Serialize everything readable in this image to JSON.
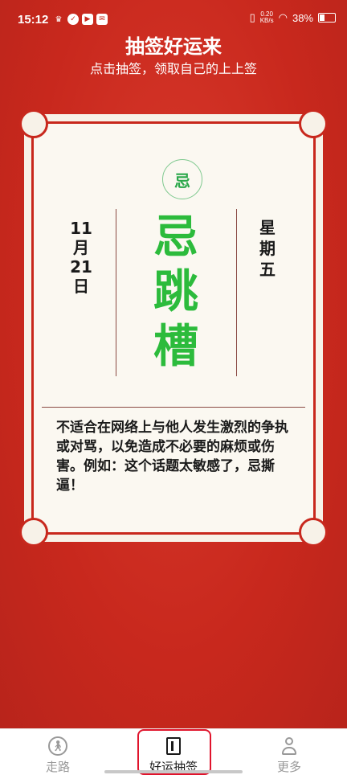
{
  "status_bar": {
    "time": "15:12",
    "net_speed": "0.20",
    "net_unit": "KB/s",
    "battery": "38%",
    "battery_level": 0.38
  },
  "header": {
    "title": "抽签好运来",
    "subtitle": "点击抽签，领取自己的上上签"
  },
  "card": {
    "badge": "忌",
    "date_chars": [
      "11",
      "月",
      "21",
      "日"
    ],
    "weekday_chars": [
      "星",
      "期",
      "五"
    ],
    "main_chars": [
      "忌",
      "跳",
      "槽"
    ],
    "description": "不适合在网络上与他人发生激烈的争执或对骂，以免造成不必要的麻烦或伤害。例如：这个话题太敏感了，忌撕逼！"
  },
  "bottom_nav": {
    "items": [
      {
        "label": "走路",
        "icon": "walk-icon"
      },
      {
        "label": "好运抽签",
        "icon": "fortune-stick-icon"
      },
      {
        "label": "更多",
        "icon": "person-icon"
      }
    ],
    "active_index": 1
  },
  "colors": {
    "background": "#c8281d",
    "accent_green": "#2cbb3c",
    "card_border": "#c8281d",
    "highlight": "#e0142c"
  }
}
